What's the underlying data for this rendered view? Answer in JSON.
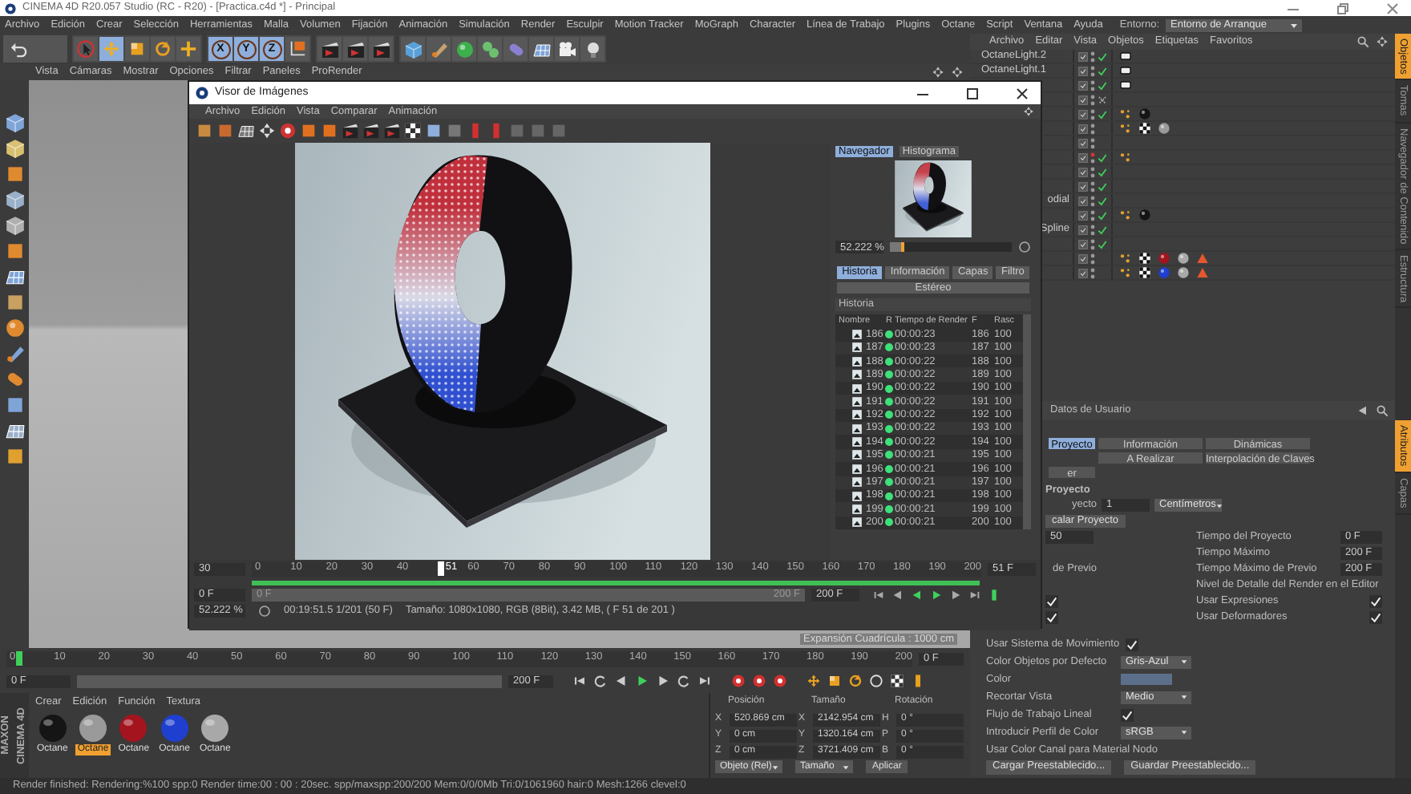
{
  "app_window": {
    "title": "CINEMA 4D R20.057 Studio (RC - R20) - [Practica.c4d *] - Principal"
  },
  "menu_bar": {
    "items": [
      "Archivo",
      "Edición",
      "Crear",
      "Selección",
      "Herramientas",
      "Malla",
      "Volumen",
      "Fijación",
      "Animación",
      "Simulación",
      "Render",
      "Esculpir",
      "Motion Tracker",
      "MoGraph",
      "Character",
      "Línea de Trabajo",
      "Plugins",
      "Octane",
      "Script",
      "Ventana",
      "Ayuda"
    ],
    "layout_label": "Entorno:",
    "layout_value": "Entorno de Arranque"
  },
  "toolbar": {
    "tools": [
      {
        "kind": "select",
        "selected": false
      },
      {
        "kind": "move",
        "selected": true
      },
      {
        "kind": "scale",
        "selected": false
      },
      {
        "kind": "rotate",
        "selected": false
      },
      {
        "kind": "add",
        "selected": false
      }
    ],
    "axes": [
      {
        "label": "X",
        "selected": true
      },
      {
        "label": "Y",
        "selected": true
      },
      {
        "label": "Z",
        "selected": true
      }
    ]
  },
  "viewport": {
    "menu": [
      "Vista",
      "Cámaras",
      "Mostrar",
      "Opciones",
      "Filtrar",
      "Paneles",
      "ProRender"
    ],
    "grid_label": "Expansión Cuadrícula : 1000 cm"
  },
  "timeline": {
    "ticks": [
      "0",
      "10",
      "20",
      "30",
      "40",
      "50",
      "60",
      "70",
      "80",
      "90",
      "100",
      "110",
      "120",
      "130",
      "140",
      "150",
      "160",
      "170",
      "180",
      "190",
      "200"
    ],
    "current_field": "0 F",
    "level": 0,
    "start_field": "0 F",
    "end_field": "200 F"
  },
  "logo": {
    "lines": [
      "MAXON",
      "CINEMA 4D"
    ]
  },
  "material_manager": {
    "menu": [
      "Crear",
      "Edición",
      "Función",
      "Textura"
    ],
    "materials": [
      {
        "label": "Octane",
        "color": "#151515",
        "selected": false
      },
      {
        "label": "Octane",
        "color": "#9a9a9a",
        "selected": true
      },
      {
        "label": "Octane",
        "color": "#a3141f",
        "selected": false
      },
      {
        "label": "Octane",
        "color": "#1f3fd0",
        "selected": false
      },
      {
        "label": "Octane",
        "color": "#a8a8a8",
        "selected": false
      }
    ]
  },
  "coordinates": {
    "headers": [
      "Posición",
      "Tamaño",
      "Rotación"
    ],
    "rows": [
      [
        {
          "axis": "X",
          "value": "520.869 cm"
        },
        {
          "axis": "X",
          "value": "2142.954 cm"
        },
        {
          "axis": "H",
          "value": "0 °"
        }
      ],
      [
        {
          "axis": "Y",
          "value": "0 cm"
        },
        {
          "axis": "Y",
          "value": "1320.164 cm"
        },
        {
          "axis": "P",
          "value": "0 °"
        }
      ],
      [
        {
          "axis": "Z",
          "value": "0 cm"
        },
        {
          "axis": "Z",
          "value": "3721.409 cm"
        },
        {
          "axis": "B",
          "value": "0 °"
        }
      ]
    ],
    "mode": "Objeto (Rel)",
    "size_mode": "Tamaño",
    "apply": "Aplicar"
  },
  "status_bar": "Render finished: Rendering:%100 spp:0 Render time:00 : 00 : 20sec. spp/maxspp:200/200 Mem:0/0/0Mb Tri:0/1061960 hair:0 Mesh:1266 clevel:0",
  "object_manager": {
    "menu": [
      "Archivo",
      "Editar",
      "Vista",
      "Objetos",
      "Etiquetas",
      "Favoritos"
    ],
    "rows": [
      {
        "name": "OctaneLight.2",
        "clipped": false,
        "hidden_in_editor": false,
        "checked": true,
        "crossed": false,
        "tags": [
          {
            "kind": "light"
          }
        ]
      },
      {
        "name": "OctaneLight.1",
        "clipped": false,
        "hidden_in_editor": false,
        "checked": true,
        "crossed": false,
        "tags": [
          {
            "kind": "light"
          }
        ]
      },
      {
        "hidden_in_editor": false,
        "checked": true,
        "crossed": false,
        "tags": [
          {
            "kind": "light"
          }
        ]
      },
      {
        "hidden_in_editor": false,
        "checked": false,
        "crossed": true,
        "tags": []
      },
      {
        "hidden_in_editor": false,
        "checked": true,
        "crossed": false,
        "tags": [
          {
            "kind": "phong"
          },
          {
            "kind": "material",
            "color": "#151515"
          }
        ]
      },
      {
        "hidden_in_editor": false,
        "checked": false,
        "crossed": false,
        "tags": [
          {
            "kind": "phong"
          },
          {
            "kind": "checker"
          },
          {
            "kind": "material",
            "color": "#9a9a9a"
          }
        ]
      },
      {
        "hidden_in_editor": false,
        "checked": false,
        "crossed": false,
        "tags": []
      },
      {
        "hidden_in_editor": true,
        "checked": true,
        "crossed": false,
        "tags": [
          {
            "kind": "phong"
          }
        ]
      },
      {
        "hidden_in_editor": false,
        "checked": true,
        "crossed": false,
        "tags": []
      },
      {
        "hidden_in_editor": false,
        "checked": true,
        "crossed": false,
        "tags": []
      },
      {
        "name": "odial",
        "clipped": true,
        "hidden_in_editor": false,
        "checked": true,
        "crossed": false,
        "tags": []
      },
      {
        "hidden_in_editor": false,
        "checked": true,
        "crossed": false,
        "tags": [
          {
            "kind": "phong"
          },
          {
            "kind": "material",
            "color": "#151515"
          }
        ]
      },
      {
        "name": "Spline",
        "clipped": true,
        "hidden_in_editor": false,
        "checked": true,
        "crossed": false,
        "tags": []
      },
      {
        "hidden_in_editor": false,
        "checked": true,
        "crossed": false,
        "tags": []
      },
      {
        "hidden_in_editor": false,
        "checked": false,
        "crossed": false,
        "tags": [
          {
            "kind": "phong"
          },
          {
            "kind": "checker"
          },
          {
            "kind": "material",
            "color": "#a3141f"
          },
          {
            "kind": "material",
            "color": "#a8a8a8"
          },
          {
            "kind": "warning"
          }
        ]
      },
      {
        "hidden_in_editor": false,
        "checked": false,
        "crossed": false,
        "tags": [
          {
            "kind": "phong"
          },
          {
            "kind": "checker"
          },
          {
            "kind": "material",
            "color": "#1f3fd0"
          },
          {
            "kind": "material",
            "color": "#a8a8a8"
          },
          {
            "kind": "warning"
          }
        ]
      }
    ]
  },
  "side_tabs": {
    "top": [
      {
        "label": "Objetos",
        "selected": true
      },
      {
        "label": "Tomas",
        "selected": false
      },
      {
        "label": "Navegador de Contenido",
        "selected": false
      },
      {
        "label": "Estructura",
        "selected": false
      }
    ],
    "bottom": [
      {
        "label": "Atributos",
        "selected": true
      },
      {
        "label": "Capas",
        "selected": false
      }
    ]
  },
  "attributes": {
    "title": "Datos de Usuario",
    "tab_rows": [
      [
        {
          "label": "Proyecto",
          "selected": true
        },
        {
          "label": "Información",
          "selected": false
        },
        {
          "label": "Dinámicas",
          "selected": false
        }
      ],
      [
        {
          "label": "A Realizar",
          "selected": false
        },
        {
          "label": "Interpolación de Claves",
          "selected": false
        }
      ],
      [
        {
          "label": "er",
          "selected": false
        }
      ]
    ],
    "rows": [
      {
        "kind": "heading",
        "label": "Proyecto"
      },
      {
        "kind": "pair",
        "left": {
          "label": "yecto",
          "value": "1",
          "choice": "Centímetros"
        }
      },
      {
        "kind": "pair",
        "left": {
          "button": "calar Proyecto"
        }
      },
      {
        "kind": "pair",
        "left": {
          "value": "50"
        },
        "right": {
          "label": "Tiempo del Proyecto",
          "value": "0 F"
        }
      },
      {
        "kind": "pair",
        "right": {
          "label": "Tiempo Máximo",
          "value": "200 F"
        }
      },
      {
        "kind": "pair",
        "left": {
          "label": "de Previo"
        },
        "right": {
          "label": "Tiempo Máximo de Previo",
          "value": "200 F"
        }
      },
      {
        "kind": "pair",
        "right": {
          "label": "Nivel de Detalle del Render en el Editor"
        }
      },
      {
        "kind": "pair",
        "left": {
          "checked": true
        },
        "right": {
          "label": "Usar Expresiones",
          "checked": true
        }
      },
      {
        "kind": "pair",
        "left": {
          "checked": true
        },
        "right": {
          "label": "Usar Deformadores",
          "checked": true
        }
      },
      {
        "kind": "wide",
        "label": "Usar Sistema de Movimiento",
        "checked": true
      },
      {
        "kind": "wide",
        "label": "Color Objetos por Defecto",
        "choice": "Gris-Azul"
      },
      {
        "kind": "wide",
        "label": "Color",
        "color": "#5c6f8a"
      },
      {
        "kind": "wide",
        "label": "Recortar Vista",
        "choice": "Medio"
      },
      {
        "kind": "wide",
        "label": "Flujo de Trabajo Lineal",
        "checked": true
      },
      {
        "kind": "wide",
        "label": "Introducir Perfil de Color",
        "choice": "sRGB"
      },
      {
        "kind": "wide",
        "label": "Usar Color Canal para Material Nodo"
      },
      {
        "kind": "buttons",
        "buttons": [
          "Cargar Preestablecido...",
          "Guardar Preestablecido..."
        ]
      }
    ]
  },
  "picture_viewer": {
    "title": "Visor de Imágenes",
    "menu": [
      "Archivo",
      "Edición",
      "Vista",
      "Comparar",
      "Animación"
    ],
    "nav_tabs": [
      {
        "label": "Navegador",
        "selected": true
      },
      {
        "label": "Histograma",
        "selected": false
      }
    ],
    "zoom": {
      "value": "52.222 %",
      "level": 0.12
    },
    "info_tabs": [
      {
        "label": "Historia",
        "selected": true
      },
      {
        "label": "Información",
        "selected": false
      },
      {
        "label": "Capas",
        "selected": false
      },
      {
        "label": "Filtro",
        "selected": false
      },
      {
        "label": "Estéreo",
        "selected": false
      }
    ],
    "history": {
      "title": "Historia",
      "columns": [
        "Nombre",
        "R",
        "Tiempo de Render",
        "F",
        "Rasc"
      ],
      "rows": [
        {
          "name": "186",
          "color": "#3ee07a",
          "time": "00:00:23",
          "frame": "186",
          "ratio": "100"
        },
        {
          "name": "187",
          "color": "#3ee07a",
          "time": "00:00:23",
          "frame": "187",
          "ratio": "100"
        },
        {
          "name": "188",
          "color": "#3ee07a",
          "time": "00:00:22",
          "frame": "188",
          "ratio": "100"
        },
        {
          "name": "189",
          "color": "#3ee07a",
          "time": "00:00:22",
          "frame": "189",
          "ratio": "100"
        },
        {
          "name": "190",
          "color": "#3ee07a",
          "time": "00:00:22",
          "frame": "190",
          "ratio": "100"
        },
        {
          "name": "191",
          "color": "#3ee07a",
          "time": "00:00:22",
          "frame": "191",
          "ratio": "100"
        },
        {
          "name": "192",
          "color": "#3ee07a",
          "time": "00:00:22",
          "frame": "192",
          "ratio": "100"
        },
        {
          "name": "193",
          "color": "#3ee07a",
          "time": "00:00:22",
          "frame": "193",
          "ratio": "100"
        },
        {
          "name": "194",
          "color": "#3ee07a",
          "time": "00:00:22",
          "frame": "194",
          "ratio": "100"
        },
        {
          "name": "195",
          "color": "#3ee07a",
          "time": "00:00:21",
          "frame": "195",
          "ratio": "100"
        },
        {
          "name": "196",
          "color": "#3ee07a",
          "time": "00:00:21",
          "frame": "196",
          "ratio": "100"
        },
        {
          "name": "197",
          "color": "#3ee07a",
          "time": "00:00:21",
          "frame": "197",
          "ratio": "100"
        },
        {
          "name": "198",
          "color": "#3ee07a",
          "time": "00:00:21",
          "frame": "198",
          "ratio": "100"
        },
        {
          "name": "199",
          "color": "#3ee07a",
          "time": "00:00:21",
          "frame": "199",
          "ratio": "100"
        },
        {
          "name": "200",
          "color": "#3ee07a",
          "time": "00:00:21",
          "frame": "200",
          "ratio": "100"
        }
      ]
    },
    "timeline": {
      "fps": "30",
      "ticks_before": [
        "0",
        "10",
        "20",
        "30",
        "40"
      ],
      "ticks_after": [
        "60",
        "70",
        "80",
        "90",
        "100",
        "110",
        "120",
        "130",
        "140",
        "150",
        "160",
        "170",
        "180",
        "190",
        "200"
      ],
      "current": "51",
      "current_field": "51 F",
      "level": 0.255,
      "start_field": "0 F",
      "scroll_start": "0 F",
      "scroll_end": "200 F",
      "end_field": "200 F"
    },
    "status": {
      "zoom": "52.222 %",
      "time": "00:19:51.5 1/201 (50 F)",
      "info": "Tamaño: 1080x1080, RGB (8Bit), 3.42 MB,  ( F 51 de 201 )"
    }
  }
}
